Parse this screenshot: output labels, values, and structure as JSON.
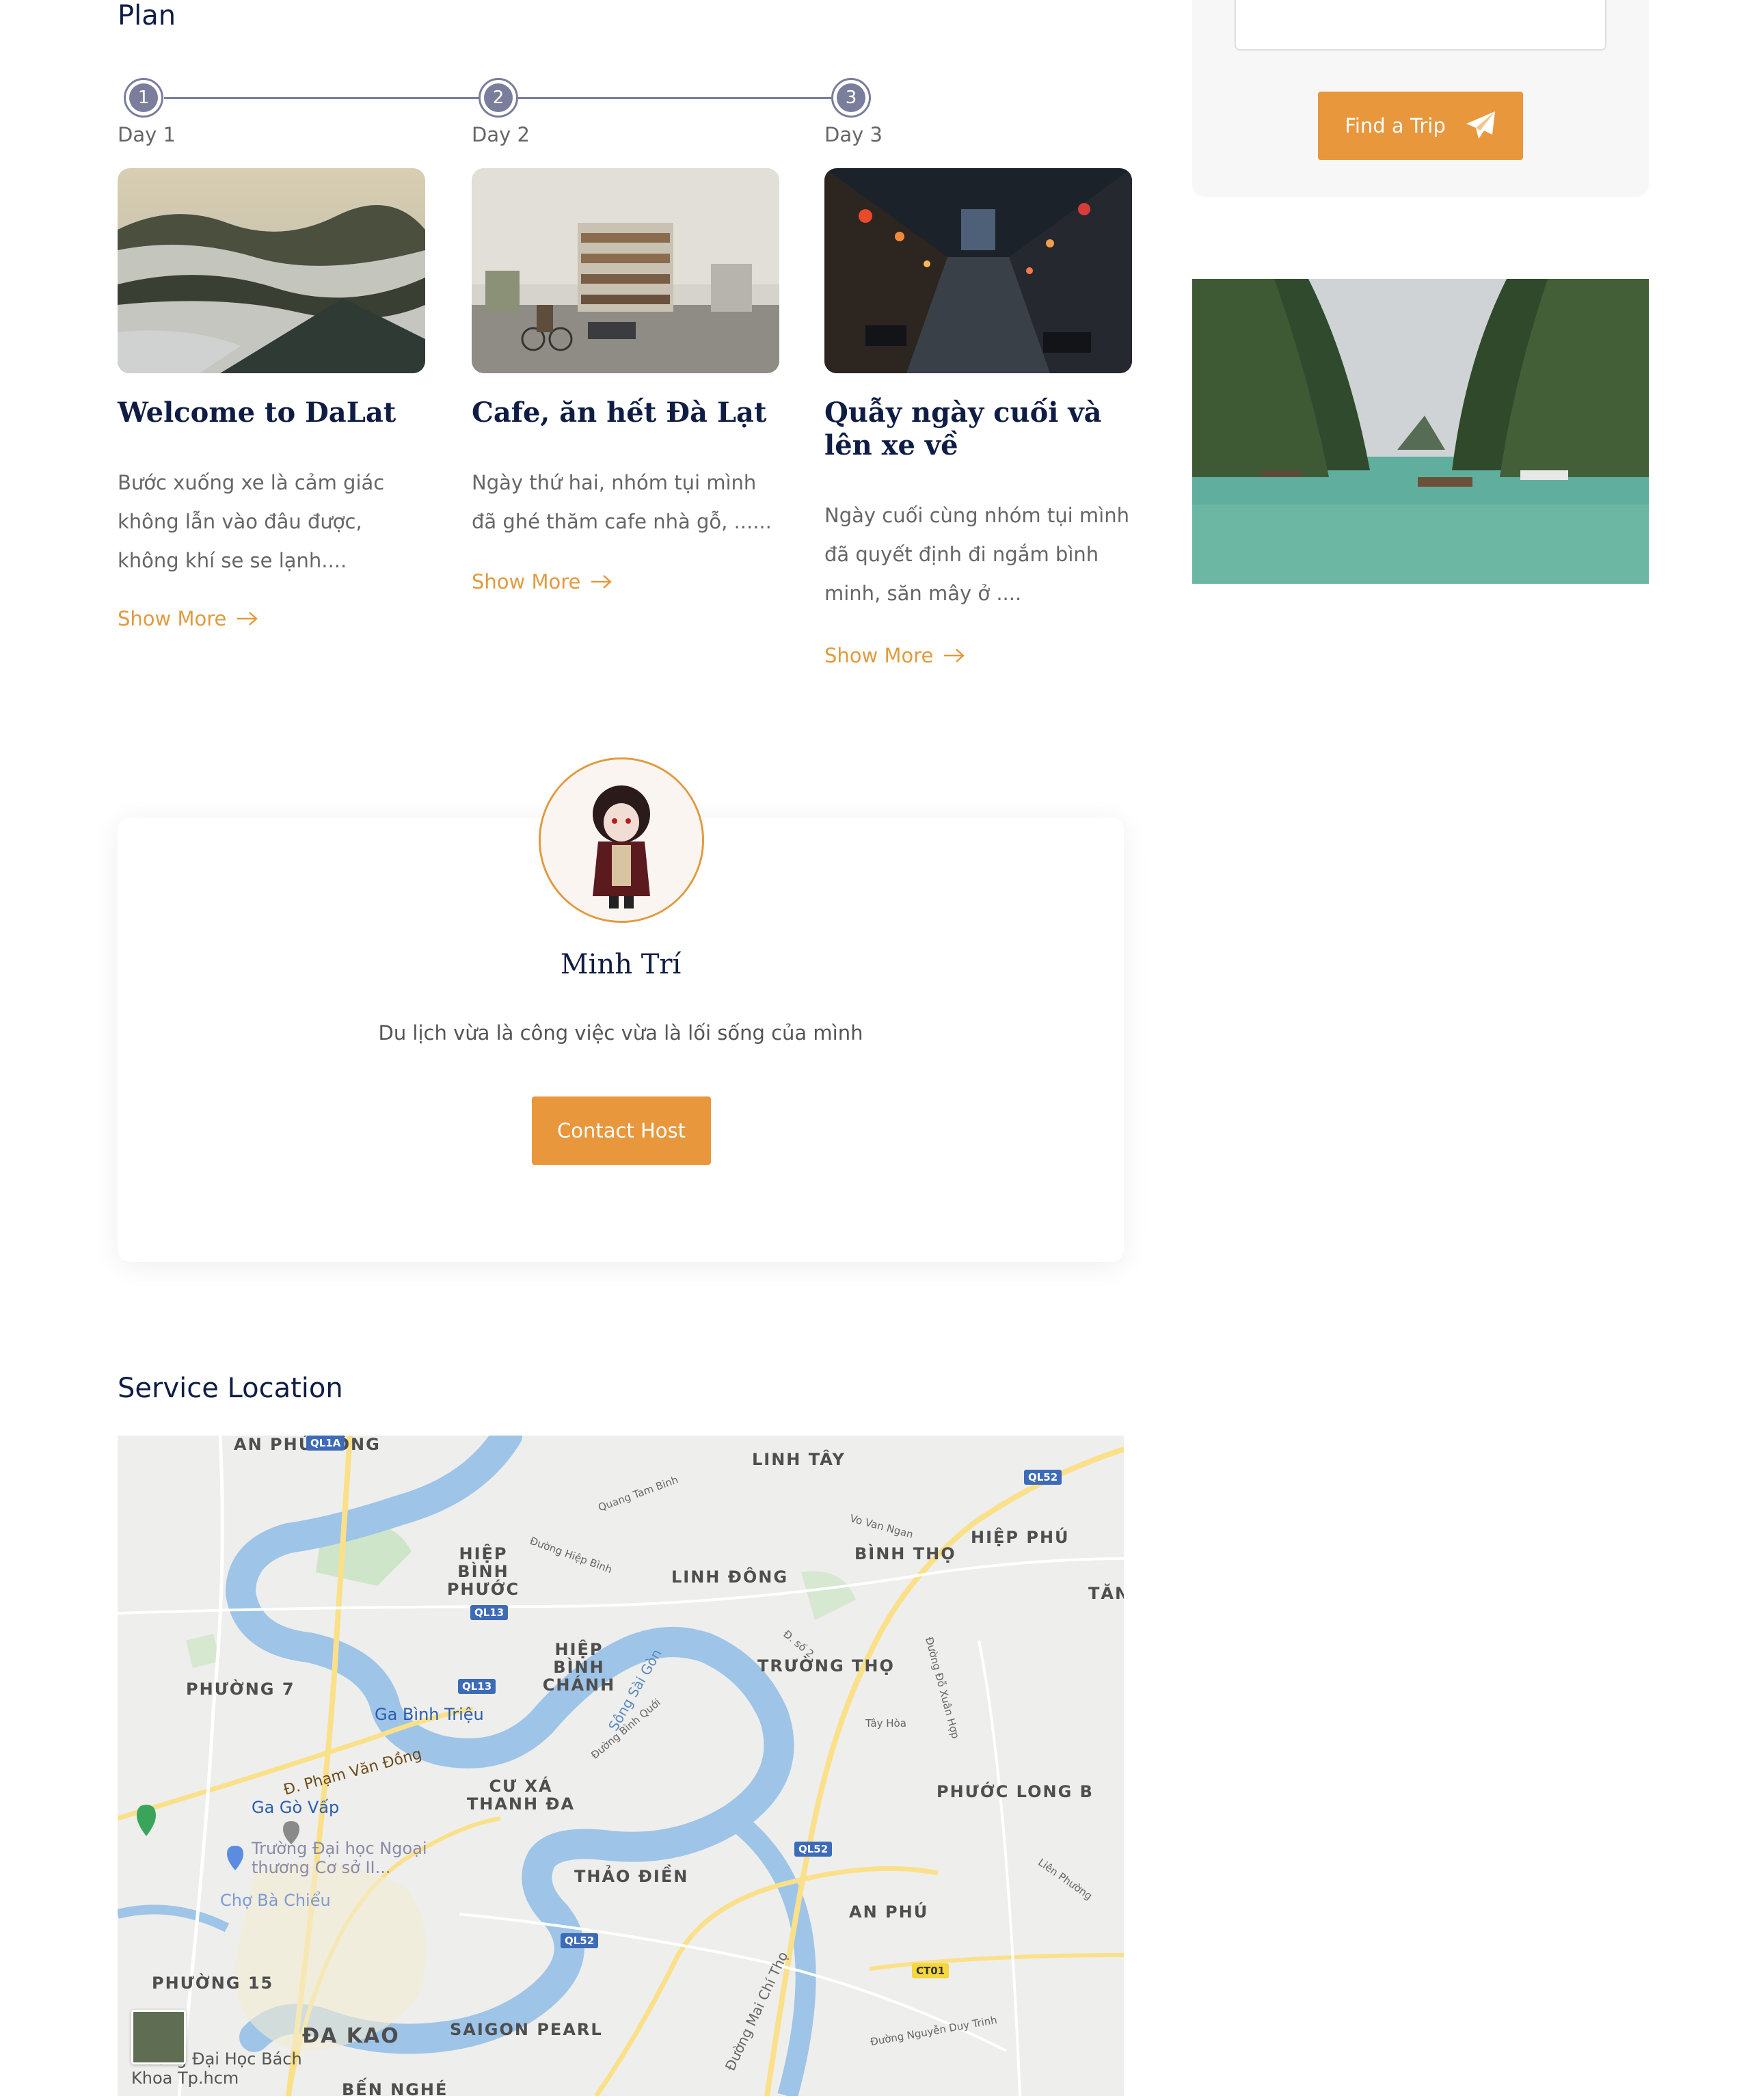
{
  "plan": {
    "title": "Plan",
    "days": [
      {
        "number": "1",
        "label": "Day 1",
        "title": "Welcome to DaLat",
        "description": "Bước xuống xe là cảm giác không lẫn vào đâu được, không khí se se lạnh....",
        "link": "Show More"
      },
      {
        "number": "2",
        "label": "Day 2",
        "title": "Cafe, ăn hết Đà Lạt",
        "description": "Ngày thứ hai, nhóm tụi mình đã ghé thăm cafe nhà gỗ, ......",
        "link": "Show More"
      },
      {
        "number": "3",
        "label": "Day 3",
        "title": "Quẫy ngày cuối và lên xe về",
        "description": "Ngày cuối cùng nhóm tụi mình đã quyết định đi ngắm bình minh, săn mây ở ....",
        "link": "Show More"
      }
    ]
  },
  "sidebar": {
    "find_button": "Find a Trip"
  },
  "host": {
    "name": "Minh Trí",
    "bio": "Du lịch vừa là công việc vừa là lối sống của mình",
    "contact_button": "Contact Host"
  },
  "location": {
    "title": "Service Location",
    "map": {
      "districts": [
        "AN PHÚ ĐÔNG",
        "LINH TÂY",
        "HIỆP PHÚ",
        "HIỆP BÌNH PHƯỚC",
        "BÌNH THỌ",
        "LINH ĐÔNG",
        "TĂN",
        "HIỆP BÌNH CHÁNH",
        "TRƯỜNG THỌ",
        "PHƯỜNG 7",
        "CƯ XÁ THANH ĐA",
        "PHƯỚC LONG B",
        "THẢO ĐIỀN",
        "AN PHÚ",
        "PHƯỜNG 15",
        "ĐA KAO",
        "SAIGON PEARL",
        "BẾN NGHÉ"
      ],
      "roads": [
        "QL1A",
        "QL52",
        "QL13",
        "QL13",
        "QL52",
        "QL52",
        "CT01"
      ],
      "streets": [
        "Quang Tam Binh",
        "Vo Van Ngan",
        "Đường Hiệp Bình",
        "Đ. số 2",
        "Sông Sài Gòn",
        "Đường Bình Quới",
        "Đ. Phạm Văn Đồng",
        "Đường Mai Chí Thọ",
        "Đường Nguyễn Duy Trinh",
        "Đường Đỗ Xuân Hợp",
        "Tây Hòa",
        "Liên Phường"
      ],
      "stations": [
        "Ga Bình Triệu",
        "Ga Gò Vấp"
      ],
      "pois": [
        "Trường Đại học Ngoại thương Cơ sở II...",
        "Chợ Bà Chiểu",
        "Trường Đại Học Bách Khoa Tp.hcm"
      ]
    }
  }
}
